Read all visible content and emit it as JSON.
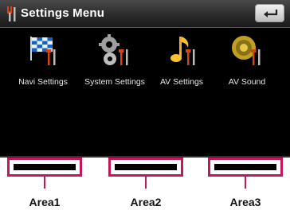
{
  "header": {
    "title": "Settings Menu",
    "title_icon": "wrench-fork-icon",
    "back_icon": "return-arrow-icon"
  },
  "menu": [
    {
      "label": "Navi Settings",
      "icon": "checkered-flag-icon"
    },
    {
      "label": "System Settings",
      "icon": "gears-icon"
    },
    {
      "label": "AV Settings",
      "icon": "music-note-icon"
    },
    {
      "label": "AV Sound",
      "icon": "speaker-icon"
    }
  ],
  "callouts": [
    {
      "label": "Area1"
    },
    {
      "label": "Area2"
    },
    {
      "label": "Area3"
    }
  ],
  "colors": {
    "callout": "#c2185b",
    "screen_background": "#000000"
  }
}
